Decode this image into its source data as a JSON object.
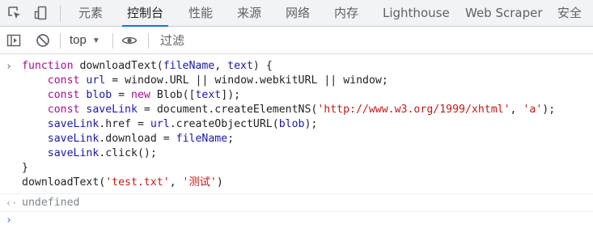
{
  "tabs": [
    {
      "label": "元素"
    },
    {
      "label": "控制台",
      "active": true
    },
    {
      "label": "性能"
    },
    {
      "label": "来源"
    },
    {
      "label": "网络"
    },
    {
      "label": "内存"
    },
    {
      "label": "Lighthouse"
    },
    {
      "label": "Web Scraper"
    },
    {
      "label": "安全"
    }
  ],
  "tab_icons": [
    "inspect-element-icon",
    "device-toolbar-icon"
  ],
  "toolbar": {
    "context": "top",
    "filter_placeholder": "过滤",
    "icons": [
      "sidebar-toggle-icon",
      "clear-console-icon",
      "eye-icon"
    ]
  },
  "console": {
    "input_lines": [
      "function downloadText(fileName, text) {",
      "    const url = window.URL || window.webkitURL || window;",
      "    const blob = new Blob([text]);",
      "    const saveLink = document.createElementNS('http://www.w3.org/1999/xhtml', 'a');",
      "    saveLink.href = url.createObjectURL(blob);",
      "    saveLink.download = fileName;",
      "    saveLink.click();",
      "}",
      "downloadText('test.txt', '测试')"
    ],
    "result": "undefined"
  },
  "colors": {
    "keyword": "#aa0d91",
    "string": "#c41a16",
    "identifier": "#1a1aa6",
    "accent": "#1a73e8"
  }
}
